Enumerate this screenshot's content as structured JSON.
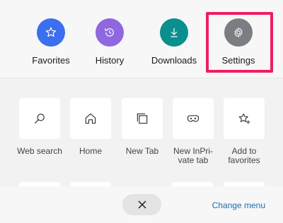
{
  "top_items": [
    {
      "label": "Favorites",
      "icon": "star-icon",
      "color": "#3b6ff0"
    },
    {
      "label": "History",
      "icon": "history-icon",
      "color": "#8f67e0"
    },
    {
      "label": "Downloads",
      "icon": "download-icon",
      "color": "#0a8f8f"
    },
    {
      "label": "Settings",
      "icon": "gear-icon",
      "color": "#7a7e82"
    }
  ],
  "highlight_color": "#ee1e5f",
  "grid_items": [
    {
      "label": "Web search",
      "icon": "search-icon"
    },
    {
      "label": "Home",
      "icon": "home-icon"
    },
    {
      "label": "New Tab",
      "icon": "new-tab-icon"
    },
    {
      "label": "New InPri-\nvate tab",
      "icon": "inprivate-icon"
    },
    {
      "label": "Add to\nfavorites",
      "icon": "add-favorite-icon"
    }
  ],
  "bottom": {
    "close_icon": "close-icon",
    "change_menu_label": "Change menu"
  }
}
